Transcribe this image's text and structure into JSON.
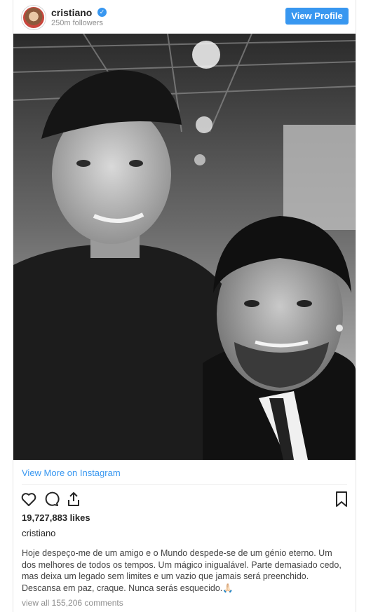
{
  "header": {
    "username": "cristiano",
    "verified_icon": "verified-badge-icon",
    "followers": "250m followers",
    "view_profile_label": "View Profile"
  },
  "post": {
    "image_alt": "Black-and-white selfie photo",
    "view_more_label": "View More on Instagram",
    "likes": "19,727,883 likes",
    "caption_user": "cristiano",
    "caption_text": "Hoje despeço-me de um amigo e o Mundo despede-se de um génio eterno. Um dos melhores de todos os tempos. Um mágico inigualável. Parte demasiado cedo, mas deixa um legado sem limites e um vazio que jamais será preenchido. Descansa em paz, craque. Nunca serás esquecido.🙏🏻",
    "comments_link": "view all 155,206 comments"
  },
  "icons": {
    "like": "heart-icon",
    "comment": "comment-icon",
    "share": "share-icon",
    "save": "bookmark-icon"
  },
  "colors": {
    "accent": "#3897f0",
    "text": "#262626",
    "muted": "#8e8e8e"
  }
}
